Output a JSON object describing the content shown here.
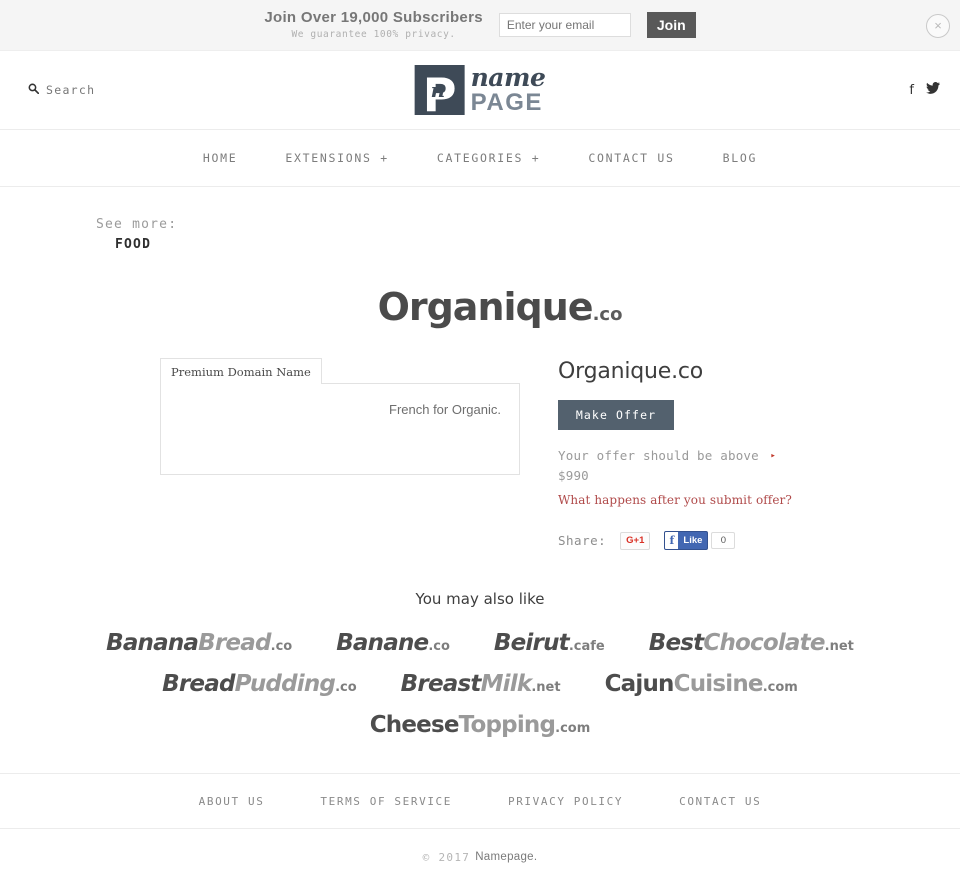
{
  "notify": {
    "headline": "Join Over 19,000 Subscribers",
    "subline": "We guarantee 100% privacy.",
    "email_value": "",
    "email_placeholder": "Enter your email",
    "join_label": "Join",
    "close_icon": "×"
  },
  "header": {
    "search_label": "Search",
    "search_icon": "⌕",
    "logo": {
      "mark_letter": "P",
      "mark_inner": "n",
      "name": "name",
      "page": "PAGE"
    },
    "social": [
      {
        "name": "facebook-icon",
        "glyph": "f"
      },
      {
        "name": "twitter-icon",
        "glyph": "ᴗ"
      }
    ]
  },
  "nav": {
    "items": [
      {
        "label": "HOME"
      },
      {
        "label": "EXTENSIONS +"
      },
      {
        "label": "CATEGORIES +"
      },
      {
        "label": "CONTACT US"
      },
      {
        "label": "BLOG"
      }
    ]
  },
  "seemore": {
    "label": "See more:",
    "category": "FOOD"
  },
  "domain": {
    "logo_main": "Organique",
    "logo_tld": ".co",
    "title": "Organique.co",
    "tab_label": "Premium Domain Name",
    "description": "French for Organic.",
    "offer_button": "Make Offer",
    "offer_note": "Your offer should be above $990",
    "offer_note_arrow": "▸",
    "offer_link": "What happens after you submit offer?",
    "share_label": "Share:",
    "gplus_label": "G+1",
    "fb_f": "f",
    "fb_like": "Like",
    "fb_count": "0",
    "accent_button_color": "#53616e",
    "accent_link_color": "#b04a4a"
  },
  "also_like": {
    "title": "You may also like",
    "rows": [
      [
        {
          "a": "Banana",
          "b": "Bread",
          "tld": ".co",
          "italic": true
        },
        {
          "a": "Banane",
          "b": "",
          "tld": ".co",
          "italic": true
        },
        {
          "a": "Beirut",
          "b": "",
          "tld": ".cafe",
          "italic": true
        },
        {
          "a": "Best",
          "b": "Chocolate",
          "tld": ".net",
          "italic": true
        }
      ],
      [
        {
          "a": "Bread",
          "b": "Pudding",
          "tld": ".co",
          "italic": true
        },
        {
          "a": "Breast",
          "b": "Milk",
          "tld": ".net",
          "italic": true
        },
        {
          "a": "Cajun",
          "b": "Cuisine",
          "tld": ".com",
          "italic": false
        }
      ],
      [
        {
          "a": "Cheese",
          "b": "Topping",
          "tld": ".com",
          "italic": false
        }
      ]
    ]
  },
  "footer": {
    "links": [
      {
        "label": "ABOUT US"
      },
      {
        "label": "TERMS OF SERVICE"
      },
      {
        "label": "PRIVACY POLICY"
      },
      {
        "label": "CONTACT US"
      }
    ],
    "copyright_symbol": "© 2017",
    "copyright_name": "Namepage."
  }
}
